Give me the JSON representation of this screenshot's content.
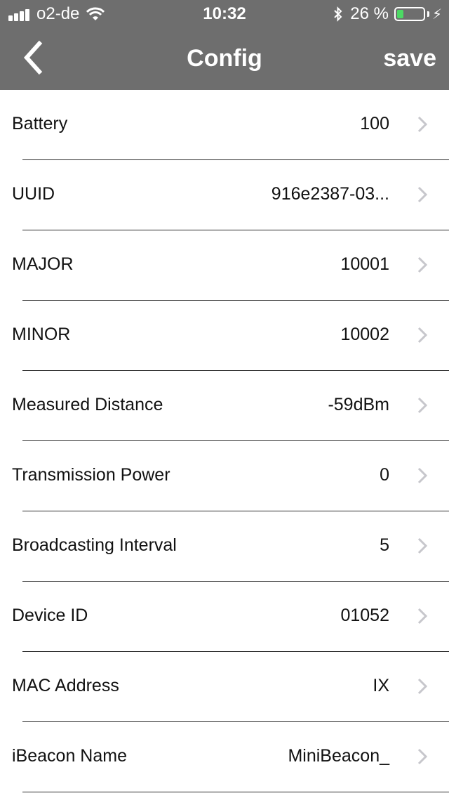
{
  "status_bar": {
    "carrier": "o2-de",
    "time": "10:32",
    "battery_percent": "26 %",
    "battery_level": 0.26,
    "icons": [
      "signal-icon",
      "wifi-icon",
      "bluetooth-icon",
      "battery-icon",
      "charging-icon"
    ]
  },
  "nav": {
    "title": "Config",
    "save_label": "save",
    "back_icon": "chevron-left-icon"
  },
  "rows": [
    {
      "label": "Battery",
      "value": "100"
    },
    {
      "label": "UUID",
      "value": "916e2387-03..."
    },
    {
      "label": "MAJOR",
      "value": "10001"
    },
    {
      "label": "MINOR",
      "value": "10002"
    },
    {
      "label": "Measured Distance",
      "value": "-59dBm"
    },
    {
      "label": "Transmission Power",
      "value": "0"
    },
    {
      "label": "Broadcasting Interval",
      "value": "5"
    },
    {
      "label": "Device ID",
      "value": "01052"
    },
    {
      "label": "MAC Address",
      "value": "IX"
    },
    {
      "label": "iBeacon Name",
      "value": "MiniBeacon_"
    }
  ],
  "colors": {
    "header_bg": "#6e6e6e",
    "header_text": "#ffffff",
    "chevron": "#c7c7cc",
    "battery_fill": "#4cd964"
  }
}
